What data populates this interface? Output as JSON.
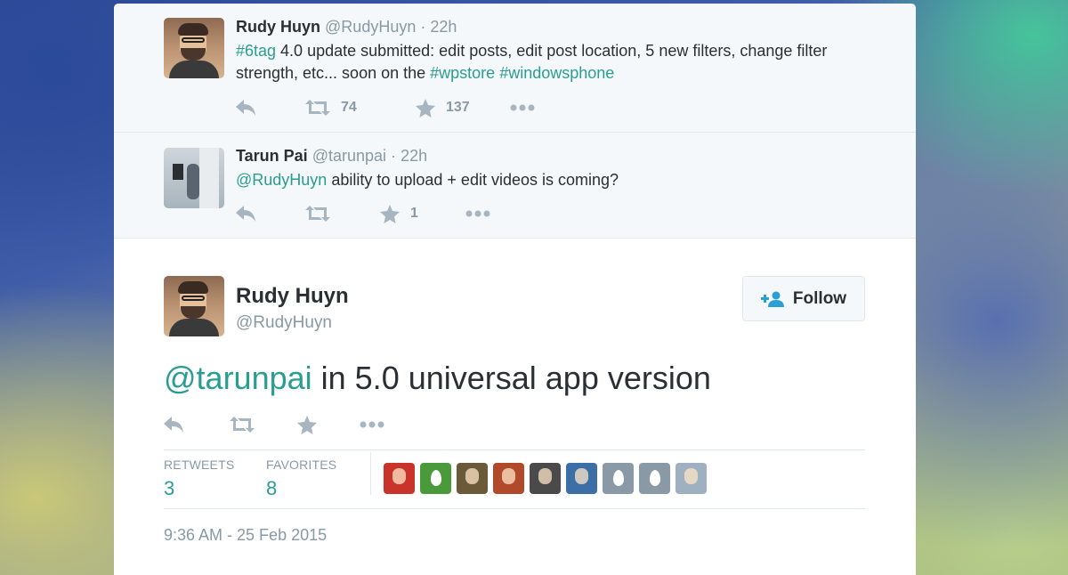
{
  "thread": [
    {
      "fullname": "Rudy Huyn",
      "handle": "@RudyHuyn",
      "dot": "·",
      "time": "22h",
      "text_parts": [
        {
          "text": "#6tag",
          "link": true
        },
        {
          "text": " 4.0 update submitted: edit posts, edit post location, 5 new filters, change filter strength, etc... soon on the ",
          "link": false
        },
        {
          "text": "#wpstore",
          "link": true
        },
        {
          "text": " ",
          "link": false
        },
        {
          "text": "#windowsphone",
          "link": true
        }
      ],
      "retweets": "74",
      "favorites": "137"
    },
    {
      "fullname": "Tarun Pai",
      "handle": "@tarunpai",
      "dot": "·",
      "time": "22h",
      "text_parts": [
        {
          "text": "@RudyHuyn",
          "link": true
        },
        {
          "text": " ability to upload + edit videos is coming?",
          "link": false
        }
      ],
      "retweets": "",
      "favorites": "1"
    }
  ],
  "main": {
    "fullname": "Rudy Huyn",
    "handle": "@RudyHuyn",
    "follow_label": "Follow",
    "mention": "@tarunpai",
    "text": " in 5.0 universal app version",
    "retweets_label": "RETWEETS",
    "retweets_value": "3",
    "favorites_label": "FAVORITES",
    "favorites_value": "8",
    "timestamp": "9:36 AM - 25 Feb 2015"
  },
  "favoriters": [
    {
      "kind": "person-red",
      "color": "#c8342a"
    },
    {
      "kind": "egg",
      "color": "#4a9a3c"
    },
    {
      "kind": "photo",
      "color": "#6a5a3a"
    },
    {
      "kind": "photo-cartoon",
      "color": "#b04a2a"
    },
    {
      "kind": "photo-bw",
      "color": "#4a4a4a"
    },
    {
      "kind": "photo-me",
      "color": "#3b6fa6"
    },
    {
      "kind": "egg",
      "color": "#8a99a6"
    },
    {
      "kind": "egg",
      "color": "#8a99a6"
    },
    {
      "kind": "photo-light",
      "color": "#9fb0c0"
    }
  ],
  "colors": {
    "link": "#2a9d91",
    "muted": "#8899a6",
    "text": "#292f33",
    "follow_icon": "#2a9fd6"
  }
}
